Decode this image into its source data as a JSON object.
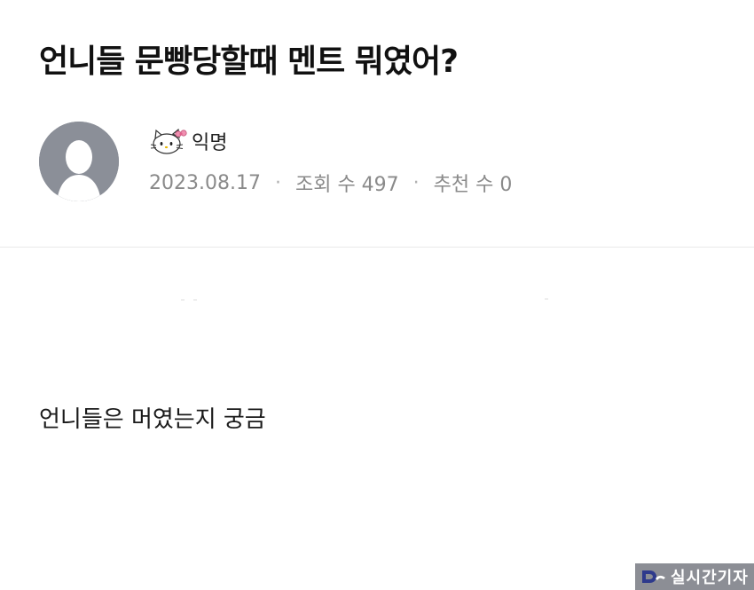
{
  "post": {
    "title": "언니들 문빵당할때 멘트 뭐였어?",
    "author": "익명",
    "date": "2023.08.17",
    "views": "조회 수 497",
    "recommends": "추천 수 0",
    "meta_separator": "·",
    "body": "언니들은 머였는지 궁금"
  },
  "icons": {
    "avatar": "default-user-silhouette",
    "author_badge": "hello-kitty-icon"
  },
  "watermark": {
    "text": "실시간기자"
  },
  "colors": {
    "avatar_bg": "#8b8f98",
    "meta_text": "#8a8a8a",
    "watermark_bg": "#8c8e95"
  }
}
